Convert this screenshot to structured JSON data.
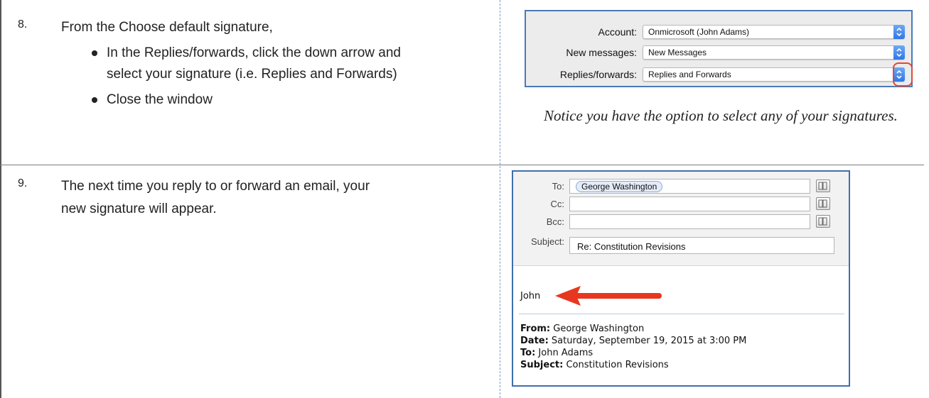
{
  "steps": [
    {
      "number": "8.",
      "text": "From the Choose default signature,",
      "bullets": [
        "In the Replies/forwards, click the down arrow and select your signature (i.e. Replies and Forwards)",
        "Close the window"
      ]
    },
    {
      "number": "9.",
      "text_line1": "The next time you reply to or forward an email, your",
      "text_line2": "new signature will appear."
    }
  ],
  "signature_panel": {
    "rows": [
      {
        "label": "Account:",
        "value": "Onmicrosoft (John Adams)"
      },
      {
        "label": "New messages:",
        "value": "New Messages"
      },
      {
        "label": "Replies/forwards:",
        "value": "Replies and Forwards"
      }
    ],
    "highlight_color": "#e0483a",
    "stepper_color": "#2f77e6"
  },
  "caption": "Notice you have the option to select any of your signatures.",
  "email": {
    "to_label": "To:",
    "to_recipient": "George Washington",
    "cc_label": "Cc:",
    "bcc_label": "Bcc:",
    "subject_label": "Subject:",
    "subject_value": "Re: Constitution Revisions",
    "signature_text": "John",
    "quoted": {
      "from_label": "From:",
      "from_value": " George Washington",
      "date_label": "Date:",
      "date_value": " Saturday, September 19, 2015 at 3:00 PM",
      "to_label": "To:",
      "to_value": " John Adams",
      "subject_label": "Subject:",
      "subject_value": " Constitution Revisions"
    },
    "arrow_color": "#e8371f"
  }
}
